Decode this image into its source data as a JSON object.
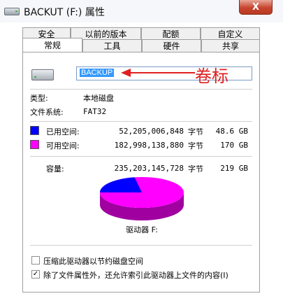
{
  "window": {
    "title": "BACKUT (F:) 属性",
    "close_glyph": "X"
  },
  "tabs_row1": [
    "安全",
    "以前的版本",
    "配额",
    "自定义"
  ],
  "tabs_row2": [
    "常规",
    "工具",
    "硬件",
    "共享"
  ],
  "general": {
    "volume_label_value": "BACKUP",
    "annotation_text": "卷标",
    "type_label": "类型:",
    "type_value": "本地磁盘",
    "fs_label": "文件系统:",
    "fs_value": "FAT32",
    "used_label": "已用空间:",
    "used_bytes": "52,205,006,848",
    "used_unit": "字节",
    "used_size": "48.6 GB",
    "free_label": "可用空间:",
    "free_bytes": "182,998,138,880",
    "free_unit": "字节",
    "free_size": "170 GB",
    "capacity_label": "容量:",
    "capacity_bytes": "235,203,145,728",
    "capacity_unit": "字节",
    "capacity_size": "219 GB",
    "drive_label": "驱动器 F:",
    "compress_label": "压缩此驱动器以节约磁盘空间",
    "compress_checked": false,
    "index_label": "除了文件属性外，还允许索引此驱动器上文件的内容(I)",
    "index_checked": true,
    "used_fraction": 0.222
  },
  "colors": {
    "used": "#0000ff",
    "free": "#ff00ff",
    "accent": "#3399ff",
    "annotation": "#e02020"
  }
}
